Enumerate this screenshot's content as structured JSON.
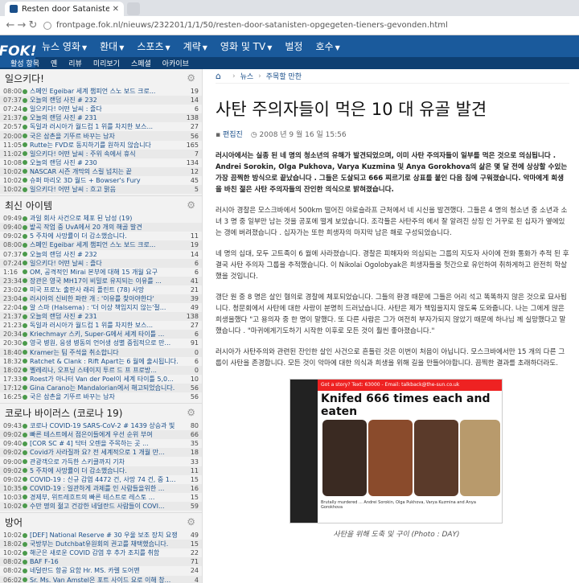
{
  "browser": {
    "tab_title": "Resten door Satanisten opgegeten",
    "url": "frontpage.fok.nl/nieuws/232201/1/1/50/resten-door-satanisten-opgegeten-tieners-gevonden.html"
  },
  "logo": "FOK!",
  "topnav": [
    "뉴스 영화",
    "환대",
    "스포츠",
    "계략",
    "영화 및 TV",
    "벌정",
    "호수"
  ],
  "subnav": [
    "활성 항목",
    "옌",
    "리뷰",
    "미리보기",
    "스페셜",
    "아카이브"
  ],
  "panels": [
    {
      "title": "일으키다!",
      "rows": [
        {
          "time": "08:00",
          "title": "스페인 Egeibar 세계 챔피언 스노 보드 크로...",
          "count": "19"
        },
        {
          "time": "07:37",
          "title": "오늘의 랜덤 사진 # 232",
          "count": "14"
        },
        {
          "time": "07:24",
          "title": "일으키다! 어떤 날씨 : 즐다",
          "count": "6"
        },
        {
          "time": "21:37",
          "title": "오늘의 랜덤 사진 # 231",
          "count": "138"
        },
        {
          "time": "20:57",
          "title": "독일과 러시아가 월드컵 1 위를 차지한 보스...",
          "count": "27"
        },
        {
          "time": "20:00",
          "title": "국은 삼촌을 기뚜르 바꾸는 남자",
          "count": "56"
        },
        {
          "time": "11:05",
          "title": "Rutte는 FVD로 동지하기를 원하지 않습니다",
          "count": "165"
        },
        {
          "time": "11:02",
          "title": "일으키다! 어떤 날씨 : 주위 속에서 휴식",
          "count": "7"
        },
        {
          "time": "10:08",
          "title": "오늘의 랜덤 사진 # 230",
          "count": "134"
        },
        {
          "time": "10:02",
          "title": "NASCAR 시즌 개막의 스릴 넘치는 끝",
          "count": "12"
        },
        {
          "time": "10:02",
          "title": "슈퍼 마리오 3D 월드 + Bowser's Fury",
          "count": "45"
        },
        {
          "time": "10:02",
          "title": "일으키다! 어떤 날씨 : 흐고 맑음",
          "count": "5"
        }
      ]
    },
    {
      "title": "최신 아이템",
      "rows": [
        {
          "time": "09:49",
          "title": "과일 회사 사건으로 체포 된 남성 (19)",
          "count": ""
        },
        {
          "time": "09:40",
          "title": "밭곡 작업 중 UvA에서 20 개의 해골 발견",
          "count": ""
        },
        {
          "time": "09:02",
          "title": "5 주차에 사망률이 더 감소했습니다.",
          "count": "11"
        },
        {
          "time": "08:00",
          "title": "스페인 Egeibar 세계 챔피언 스노 보드 크로...",
          "count": "19"
        },
        {
          "time": "07:37",
          "title": "오늘의 랜덤 사진 # 232",
          "count": "14"
        },
        {
          "time": "07:24",
          "title": "일으키다! 어떤 날씨 : 즐다",
          "count": "6"
        },
        {
          "time": "1:16",
          "title": "OM, 공격적인 Mirai 본부에 대해 15 개월 요구",
          "count": "6"
        },
        {
          "time": "23:34",
          "title": "장관은 영국 MH17이 비밀로 유지되는 이유를 ...",
          "count": "41"
        },
        {
          "time": "23:02",
          "title": "미국 프로노 출판사 래리 플린트 (78) 사망",
          "count": "21"
        },
        {
          "time": "23:04",
          "title": "러시아의 신비한 파란 개 : '이유를 찾아야한다'",
          "count": "39"
        },
        {
          "time": "22:04",
          "title": "알 스마 (Halsema) : '더 이상 책임지지 않는'절...",
          "count": "49"
        },
        {
          "time": "21:37",
          "title": "오늘의 랜덤 사진 # 231",
          "count": "138"
        },
        {
          "time": "21:23",
          "title": "독일과 러시아가 월드컵 1 위를 차지한 보스...",
          "count": "27"
        },
        {
          "time": "20:34",
          "title": "Kriechmayr 스키, Super-G에서 세계 타이틀 ...",
          "count": "6"
        },
        {
          "time": "20:30",
          "title": "영국 병원, 응생 병동의 언어생 성별 중립적으로 만...",
          "count": "91"
        },
        {
          "time": "18:40",
          "title": "Kramer는 팀 주석을 취소합니다",
          "count": "0"
        },
        {
          "time": "18:32",
          "title": "Ratchet & Clank : Rift Apart는 6 월에 출시됩니다.",
          "count": "6"
        },
        {
          "time": "18:02",
          "title": "벨레리나, 오프닝 스테이지 투르 드 프 프로방...",
          "count": "0"
        },
        {
          "time": "17:33",
          "title": "Roest가 아나터 Van der Poel이 세계 타이틀 5,0...",
          "count": "10"
        },
        {
          "time": "17:12",
          "title": "Gina Carano는 Mandalorian에서 해고되었습니다.",
          "count": "56"
        },
        {
          "time": "16:25",
          "title": "국은 삼촌을 기뚜르 바꾸는 남자",
          "count": "56"
        }
      ]
    },
    {
      "title": "코로나 바이러스 (코로나 19)",
      "rows": [
        {
          "time": "09:43",
          "title": "코로나 COVID-19 SARS-CoV-2 # 1439 상승과 빛",
          "count": "80"
        },
        {
          "time": "09:02",
          "title": "빠른 테스트에서 점은이들에게 우선 순위 부여",
          "count": "66"
        },
        {
          "time": "09:40",
          "title": "[COR SC # 4] 닥터 오렌을 주목하는 곳 ...",
          "count": "35"
        },
        {
          "time": "09:02",
          "title": "Covid가 사라질까 요? 전 세계적으로 1 개월 만...",
          "count": "18"
        },
        {
          "time": "09:00",
          "title": "관광객으로 가득한 스키클까지 기차",
          "count": "33"
        },
        {
          "time": "09:02",
          "title": "5 주차에 사망률이 더 감소했습니다.",
          "count": "11"
        },
        {
          "time": "09:02",
          "title": "COVID-19 : 신규 감염 4472 건, 사망 74 건, 중 1...",
          "count": "15"
        },
        {
          "time": "10:35",
          "title": "COVID-19 : 일관하게 과제를 인 사람들을위한 ...",
          "count": "16"
        },
        {
          "time": "10:03",
          "title": "경제부, 위트레흐트의 빠른 테스트로 레스토 ...",
          "count": "15"
        },
        {
          "time": "10:02",
          "title": "수만 명의 젊고 건강한 네덜란드 사람들이 COVI...",
          "count": "59"
        }
      ]
    },
    {
      "title": "방어",
      "rows": [
        {
          "time": "10:02",
          "title": "[DEF] National Reserve # 30 우울 보조 장치 요쟁",
          "count": "49"
        },
        {
          "time": "18:02",
          "title": "국방부는 Dutchbat유원회의 권고를 채택했습니다.",
          "count": "15"
        },
        {
          "time": "10:02",
          "title": "해군은 새로운 COVID 감염 후 추가 조치를 취함",
          "count": "22"
        },
        {
          "time": "08:02",
          "title": "BAF F-16",
          "count": "71"
        },
        {
          "time": "08:02",
          "title": "네덜란드 항공 요함 Hr. MS. 카렐 도어맨",
          "count": "24"
        },
        {
          "time": "06:02",
          "title": "Sr. Ms. Van Amstel은 포트 사이드 요로 이해 창...",
          "count": "4"
        },
        {
          "time": "05:02",
          "title": "The Walloon Soldier : Ereiel Gestrowel지부 위",
          "count": "4"
        }
      ]
    }
  ],
  "breadcrumb": [
    "뉴스",
    "주목할 만한"
  ],
  "article": {
    "title": "사탄 주의자들이 먹은 10 대 유골 발견",
    "author": "편집진",
    "date": "2008 년 9 월 16 일 15:56",
    "lead": "러시아에서는 실종 된 네 명의 청소년의 유해가 발견되었으며, 이미 사탄 주의자들이 일부를 먹은 것으로 의심됩니다 . Andrei Sorokin, Olga Pukhova, Varya Kuzmina 및 Anya Gorokhova의 삶은 몇 달 전에 상상할 수있는 가장 끔찍한 방식으로 끝났습니다 . 그들은 도살되고 666 찌르기로 상표를 붙인 다음 침에 구워졌습니다. 악마에게 희생을 바친 젊은 사탄 주의자들의 잔인한 의식으로 밝혀졌습니다.",
    "p1": "러시아 경찰은 모스크바에서 500km 떨어진 야로슬라프 근처에서 네 시신을 발견했다. 그들은 4 명의 청소년 중 소년과 소녀 3 명 중 일부만 남는 것을 공포에 떨게 보았습니다. 조각들은 사탄주의 에서 잘 알려진 상징 인 거꾸로 된 십자가 옆에있는 갱에 버려졌습니다 . 십자가는 또한 희생자의 마지막 남은 해로 구성되었습니다.",
    "p2": "네 명의 십대, 모두 고트족이 6 월에 사라졌습니다. 경찰은 피해자와 의심되는 그룹의 지도자 사이에 전화 통화가 추적 된 후 결국 사탄 주의자 그룹을 추적했습니다. 이 Nikolai Ogolobyak은 희생자들을 헛간으로 유인하여 취하게하고 완전히 학살했을 것입니다.",
    "p3": "갱단 원 중 8 명은 살인 혐의로 경찰에 체포되었습니다. 그들의 환경 때문에 그들은 어리 석고 똑똑하지 않은 것으로 묘사됩니다. 청문회에서 사탄에 대한 사랑이 분명히 드러났습니다. 사탄은 제가 책임을지지 않도록 도와줍니다. 나는 그에게 많은 희생을했다 \"고 용의자 중 한 명이 말했다. 또 다른 사람은 그가 여전히 부자가되지 않았기 때문에 하나님 께 실망했다고 말했습니다 . \"마귀에게기도하기 시작한 이후로 모든 것이 훨씬 좋아졌습니다.\"",
    "p4": "러시아가 사탄주의와 관련된 잔인한 살인 사건으로 흔들린 것은 이번이 처음이 아닙니다. 모스크바에서만 15 개의 다른 그룹이 사탄을 존경합니다. 모든 것이 악마에 대한 의식과 희생을 위해 길을 만들어야합니다. 끔찍한 결과를 초래하더라도.",
    "image_banner": "Got a story? Text: 63000 - Email: talkback@the-sun.co.uk",
    "image_headline": "Knifed 666 times each and eaten",
    "image_caption_small": "Brutally murdered ... Andrei Sorokin, Olga Pukhova, Varya Kuzmina and Anya Gorokhova",
    "caption": "사탄을 위해 도축 및 구이 (Photo : DAY)"
  }
}
